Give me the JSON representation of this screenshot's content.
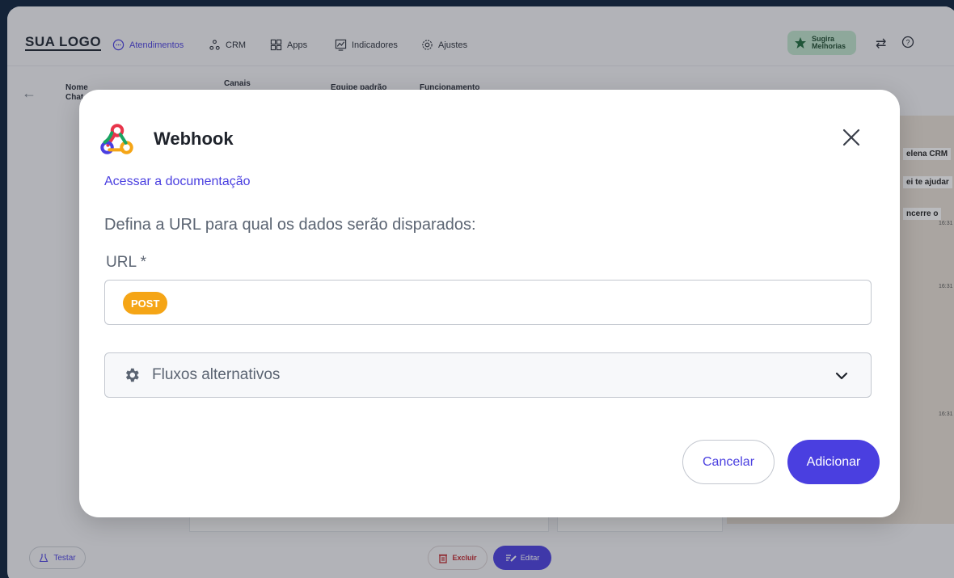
{
  "nav": {
    "logo": "SUA LOGO",
    "items": [
      {
        "label": "Atendimentos"
      },
      {
        "label": "CRM"
      },
      {
        "label": "Apps"
      },
      {
        "label": "Indicadores"
      },
      {
        "label": "Ajustes"
      }
    ],
    "suggest_line1": "Sugira",
    "suggest_line2": "Melhorias"
  },
  "subheader": {
    "col_nome": "Nome",
    "col_chat": "Chat",
    "col_canais": "Canais",
    "col_equipe": "Equipe padrão",
    "col_funcionamento": "Funcionamento"
  },
  "chat_preview": {
    "line1": "elena CRM",
    "line2": "ei te ajudar",
    "line3": "ncerre o",
    "times": [
      "16:31",
      "16:31",
      "16:31"
    ]
  },
  "bottom": {
    "test_label": "Testar",
    "delete_label": "Excluir",
    "edit_label": "Editar"
  },
  "modal": {
    "title": "Webhook",
    "doc_link": "Acessar a documentação",
    "description": "Defina a URL para qual os dados serão disparados:",
    "url_label": "URL *",
    "method": "POST",
    "url_value": "",
    "alt_flows_label": "Fluxos alternativos",
    "cancel_label": "Cancelar",
    "add_label": "Adicionar"
  },
  "colors": {
    "primary": "#4a3fe0",
    "method_badge": "#f5a516",
    "danger": "#c0262d"
  }
}
